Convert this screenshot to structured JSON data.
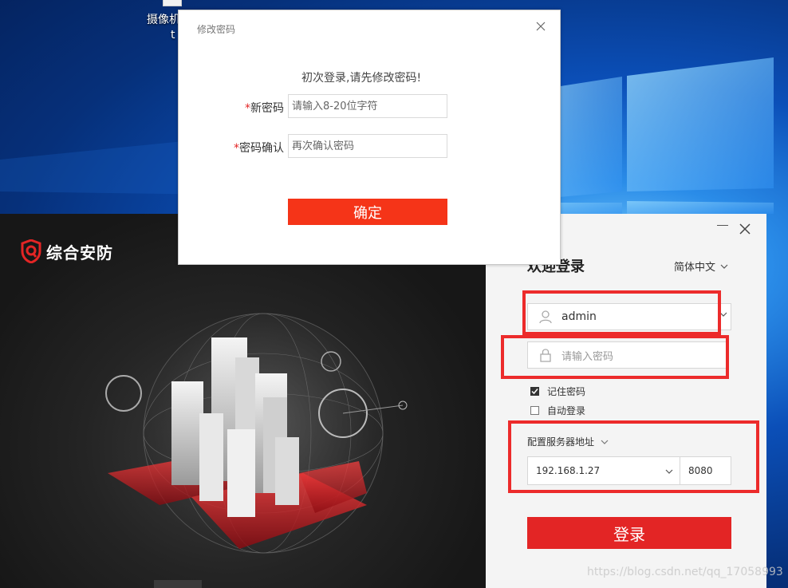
{
  "desktop": {
    "icon_label_line1": "摄像机",
    "icon_label_line2": "t"
  },
  "app": {
    "brand_name": "综合安防",
    "welcome": "欢迎登录",
    "language": "简体中文",
    "username_value": "admin",
    "password_placeholder": "请输入密码",
    "remember_label": "记住密码",
    "remember_checked": true,
    "autologin_label": "自动登录",
    "autologin_checked": false,
    "server_label": "配置服务器地址",
    "server_ip": "192.168.1.27",
    "server_port": "8080",
    "login_label": "登录",
    "accent_color": "#e32525"
  },
  "modal": {
    "title": "修改密码",
    "message": "初次登录,请先修改密码!",
    "required_mark": "*",
    "new_password_label": "新密码",
    "new_password_placeholder": "请输入8-20位字符",
    "confirm_label": "密码确认",
    "confirm_placeholder": "再次确认密码",
    "ok_label": "确定",
    "button_color": "#f53418"
  },
  "watermark": "https://blog.csdn.net/qq_17058993"
}
